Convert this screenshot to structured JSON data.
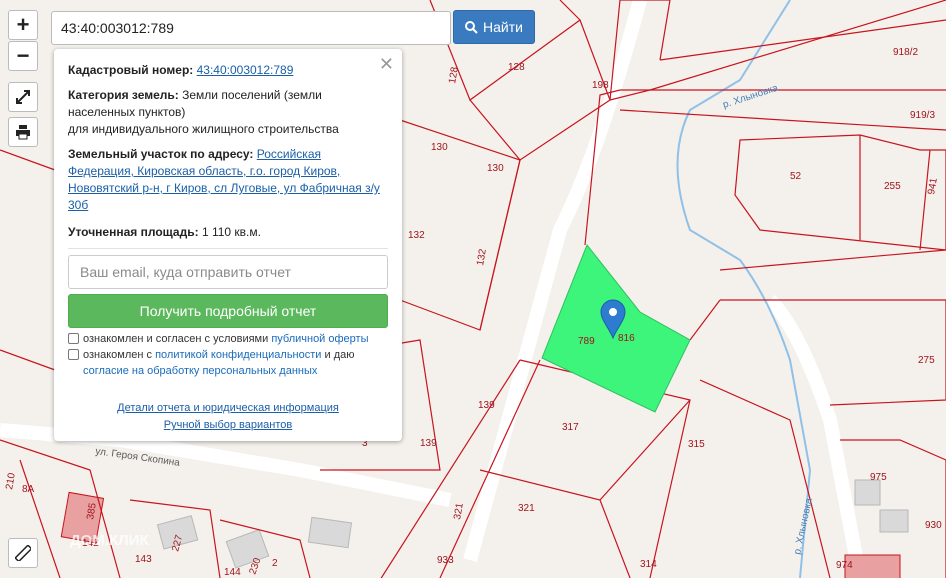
{
  "search": {
    "value": "43:40:003012:789",
    "button_label": "Найти"
  },
  "map_controls": {
    "zoom_in": "+",
    "zoom_out": "−"
  },
  "panel": {
    "cadastral_label": "Кадастровый номер:",
    "cadastral_number": "43:40:003012:789",
    "category_label": "Категория земель:",
    "category_value": "Земли поселений (земли населенных пунктов)",
    "category_use": "для индивидуального жилищного строительства",
    "address_label": "Земельный участок по адресу:",
    "address_value": "Российская Федерация, Кировская область, г.о. город Киров, Нововятский р-н, г Киров, сл Луговые, ул Фабричная з/у 30б",
    "area_label": "Уточненная площадь:",
    "area_value": "1 110 кв.м.",
    "email_placeholder": "Ваш email, куда отправить отчет",
    "report_button": "Получить подробный отчет",
    "consent1_text": "ознакомлен и согласен с условиями ",
    "consent1_link": "публичной оферты",
    "consent2_text": "ознакомлен с ",
    "consent2_link": "политикой конфиденциальности",
    "consent2_tail": " и даю",
    "consent2_link2": "согласие на обработку персональных данных",
    "details_link": "Детали отчета и юридическая информация",
    "manual_link": "Ручной выбор вариантов"
  },
  "map": {
    "selected_plot": "789",
    "plot_labels": [
      "128",
      "128",
      "198",
      "918/2",
      "919/3",
      "130",
      "130",
      "52",
      "255",
      "941",
      "132",
      "132",
      "816",
      "275",
      "139",
      "139",
      "317",
      "315",
      "321",
      "975",
      "930",
      "974",
      "933",
      "314",
      "321",
      "210",
      "8А",
      "385",
      "142",
      "143",
      "227",
      "230",
      "2",
      "144",
      "3"
    ],
    "street_label": "ул. Героя Скопина",
    "river_label_1": "р. Хлыновка",
    "river_label_2": "р. Хлыновка",
    "watermark": "ДОМ.КЛИК",
    "highlight_color": "#3cf57a",
    "boundary_color": "#c8141e"
  }
}
